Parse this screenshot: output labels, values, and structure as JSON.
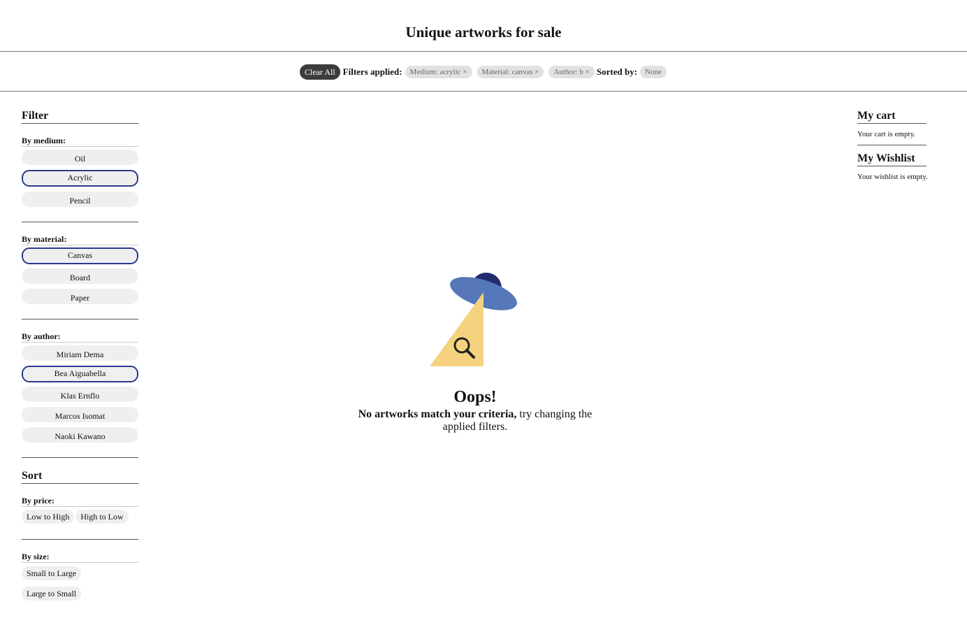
{
  "header": {
    "title": "Unique artworks for sale"
  },
  "filterbar": {
    "clear_all": "Clear All",
    "filters_label": "Filters applied:",
    "filters": [
      "Medium: acrylic ×",
      "Material: canvas ×",
      "Author: b ×"
    ],
    "sorted_label": "Sorted by:",
    "sorted_value": "None"
  },
  "sidebar": {
    "filter_heading": "Filter",
    "medium": {
      "label": "By medium:",
      "options": [
        "Oil",
        "Acrylic",
        "Pencil"
      ],
      "selected": "Acrylic"
    },
    "material": {
      "label": "By material:",
      "options": [
        "Canvas",
        "Board",
        "Paper"
      ],
      "selected": "Canvas"
    },
    "author": {
      "label": "By author:",
      "options": [
        "Miriam Dema",
        "Bea Aiguabella",
        "Klas Ernflo",
        "Marcos Isomat",
        "Naoki Kawano"
      ],
      "selected": "Bea Aiguabella"
    },
    "sort_heading": "Sort",
    "price": {
      "label": "By price:",
      "options": [
        "Low to High",
        "High to Low"
      ]
    },
    "size": {
      "label": "By size:",
      "options": [
        "Small to Large",
        "Large to Small"
      ]
    }
  },
  "cart": {
    "heading": "My cart",
    "empty_text": "Your cart is empty."
  },
  "wishlist": {
    "heading": "My Wishlist",
    "empty_text": "Your wishlist is empty."
  },
  "empty_state": {
    "title": "Oops!",
    "message_bold": "No artworks match your criteria,",
    "message_rest": " try changing the applied filters.",
    "icon": "ufo-search-icon"
  },
  "colors": {
    "selected_border": "#2b3a8f",
    "ufo_dome": "#1f2d6b",
    "ufo_disc": "#5677b9",
    "beam": "#f5d27e",
    "clear_all_bg": "#3c3c3c"
  }
}
